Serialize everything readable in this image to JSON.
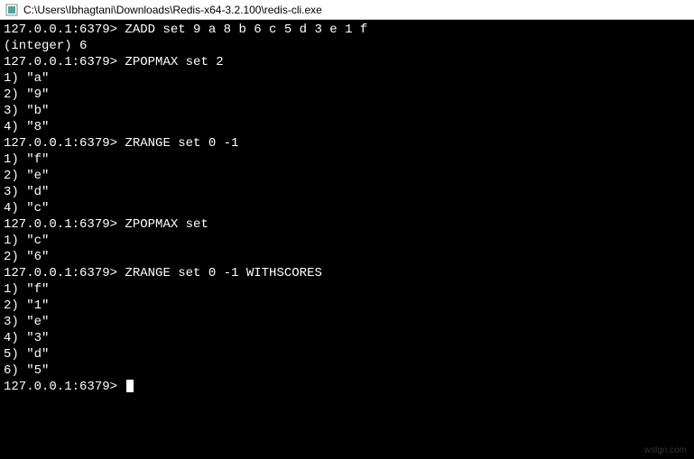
{
  "window": {
    "title": "C:\\Users\\Ibhagtani\\Downloads\\Redis-x64-3.2.100\\redis-cli.exe"
  },
  "terminal": {
    "prompt": "127.0.0.1:6379>",
    "lines": [
      {
        "type": "cmd",
        "prompt": "127.0.0.1:6379>",
        "text": " ZADD set 9 a 8 b 6 c 5 d 3 e 1 f"
      },
      {
        "type": "out",
        "text": "(integer) 6"
      },
      {
        "type": "cmd",
        "prompt": "127.0.0.1:6379>",
        "text": " ZPOPMAX set 2"
      },
      {
        "type": "out",
        "text": "1) \"a\""
      },
      {
        "type": "out",
        "text": "2) \"9\""
      },
      {
        "type": "out",
        "text": "3) \"b\""
      },
      {
        "type": "out",
        "text": "4) \"8\""
      },
      {
        "type": "cmd",
        "prompt": "127.0.0.1:6379>",
        "text": " ZRANGE set 0 -1"
      },
      {
        "type": "out",
        "text": "1) \"f\""
      },
      {
        "type": "out",
        "text": "2) \"e\""
      },
      {
        "type": "out",
        "text": "3) \"d\""
      },
      {
        "type": "out",
        "text": "4) \"c\""
      },
      {
        "type": "cmd",
        "prompt": "127.0.0.1:6379>",
        "text": " ZPOPMAX set"
      },
      {
        "type": "out",
        "text": "1) \"c\""
      },
      {
        "type": "out",
        "text": "2) \"6\""
      },
      {
        "type": "cmd",
        "prompt": "127.0.0.1:6379>",
        "text": " ZRANGE set 0 -1 WITHSCORES"
      },
      {
        "type": "out",
        "text": "1) \"f\""
      },
      {
        "type": "out",
        "text": "2) \"1\""
      },
      {
        "type": "out",
        "text": "3) \"e\""
      },
      {
        "type": "out",
        "text": "4) \"3\""
      },
      {
        "type": "out",
        "text": "5) \"d\""
      },
      {
        "type": "out",
        "text": "6) \"5\""
      }
    ],
    "active_prompt": "127.0.0.1:6379> "
  },
  "watermark": "wslgn.com"
}
